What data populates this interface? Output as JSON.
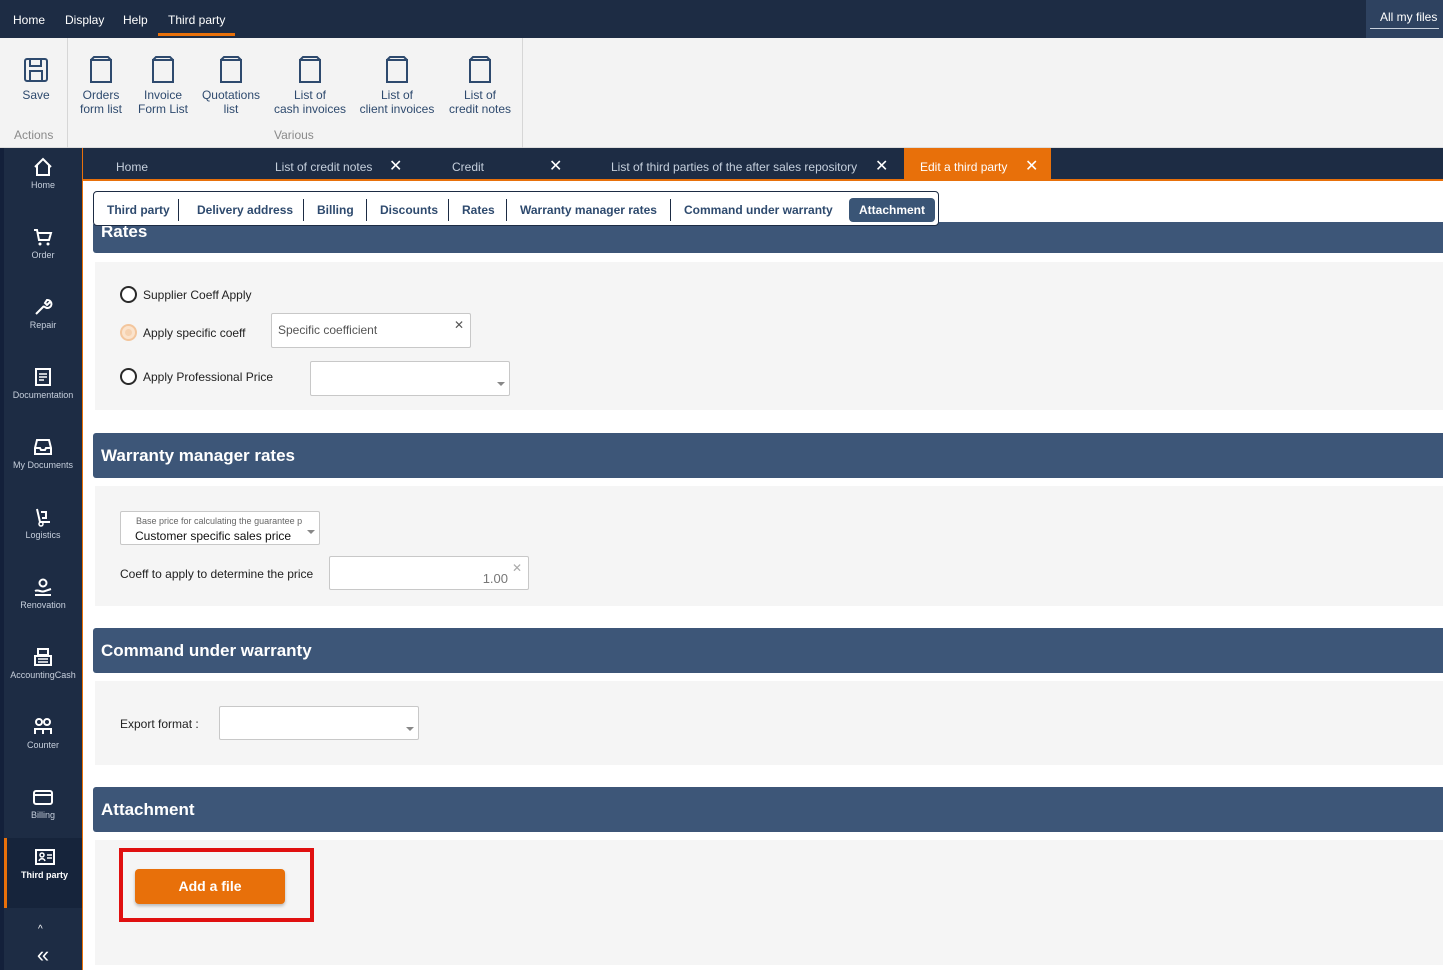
{
  "top_menu": {
    "items": [
      "Home",
      "Display",
      "Help",
      "Third party"
    ],
    "active": "Third party",
    "all_files": "All my files"
  },
  "ribbon": {
    "actions_label": "Actions",
    "various_label": "Various",
    "save": "Save",
    "buttons": [
      {
        "line1": "Orders",
        "line2": "form list"
      },
      {
        "line1": "Invoice",
        "line2": "Form List"
      },
      {
        "line1": "Quotations",
        "line2": "list"
      },
      {
        "line1": "List of",
        "line2": "cash invoices"
      },
      {
        "line1": "List of",
        "line2": "client invoices"
      },
      {
        "line1": "List of",
        "line2": "credit notes"
      }
    ]
  },
  "sidenav": {
    "items": [
      "Home",
      "Order",
      "Repair",
      "Documentation",
      "My Documents",
      "Logistics",
      "Renovation",
      "AccountingCash",
      "Counter",
      "Billing",
      "Third party"
    ],
    "active": "Third party",
    "collapse": "«"
  },
  "doc_tabs": [
    {
      "label": "Home",
      "close": ""
    },
    {
      "label": "List of credit notes",
      "close": "✕"
    },
    {
      "label": "Credit",
      "close": "✕"
    },
    {
      "label": "List of third parties of the after sales repository",
      "close": "✕"
    },
    {
      "label": "Edit a third party",
      "close": "✕"
    }
  ],
  "section_tabs": [
    "Third party",
    "Delivery address",
    "Billing",
    "Discounts",
    "Rates",
    "Warranty manager rates",
    "Command under warranty",
    "Attachment"
  ],
  "active_section_tab": "Attachment",
  "rates": {
    "header": "Rates",
    "supplier_coeff": "Supplier Coeff Apply",
    "specific_coeff": "Apply specific coeff",
    "specific_coeff_placeholder": "Specific coefficient",
    "professional_price": "Apply Professional Price",
    "clear": "✕"
  },
  "warranty": {
    "header": "Warranty manager rates",
    "base_price_label": "Base price for calculating the guarantee p",
    "base_price_value": "Customer specific sales price",
    "coeff_label": "Coeff to apply to determine the price",
    "coeff_value": "1.00",
    "clear": "✕"
  },
  "command": {
    "header": "Command under warranty",
    "export_label": "Export format :"
  },
  "attachment": {
    "header": "Attachment",
    "add_file": "Add a file"
  },
  "colors": {
    "navy": "#1d2c44",
    "section_header": "#3d5678",
    "accent": "#e8700a",
    "highlight": "#e01010"
  }
}
